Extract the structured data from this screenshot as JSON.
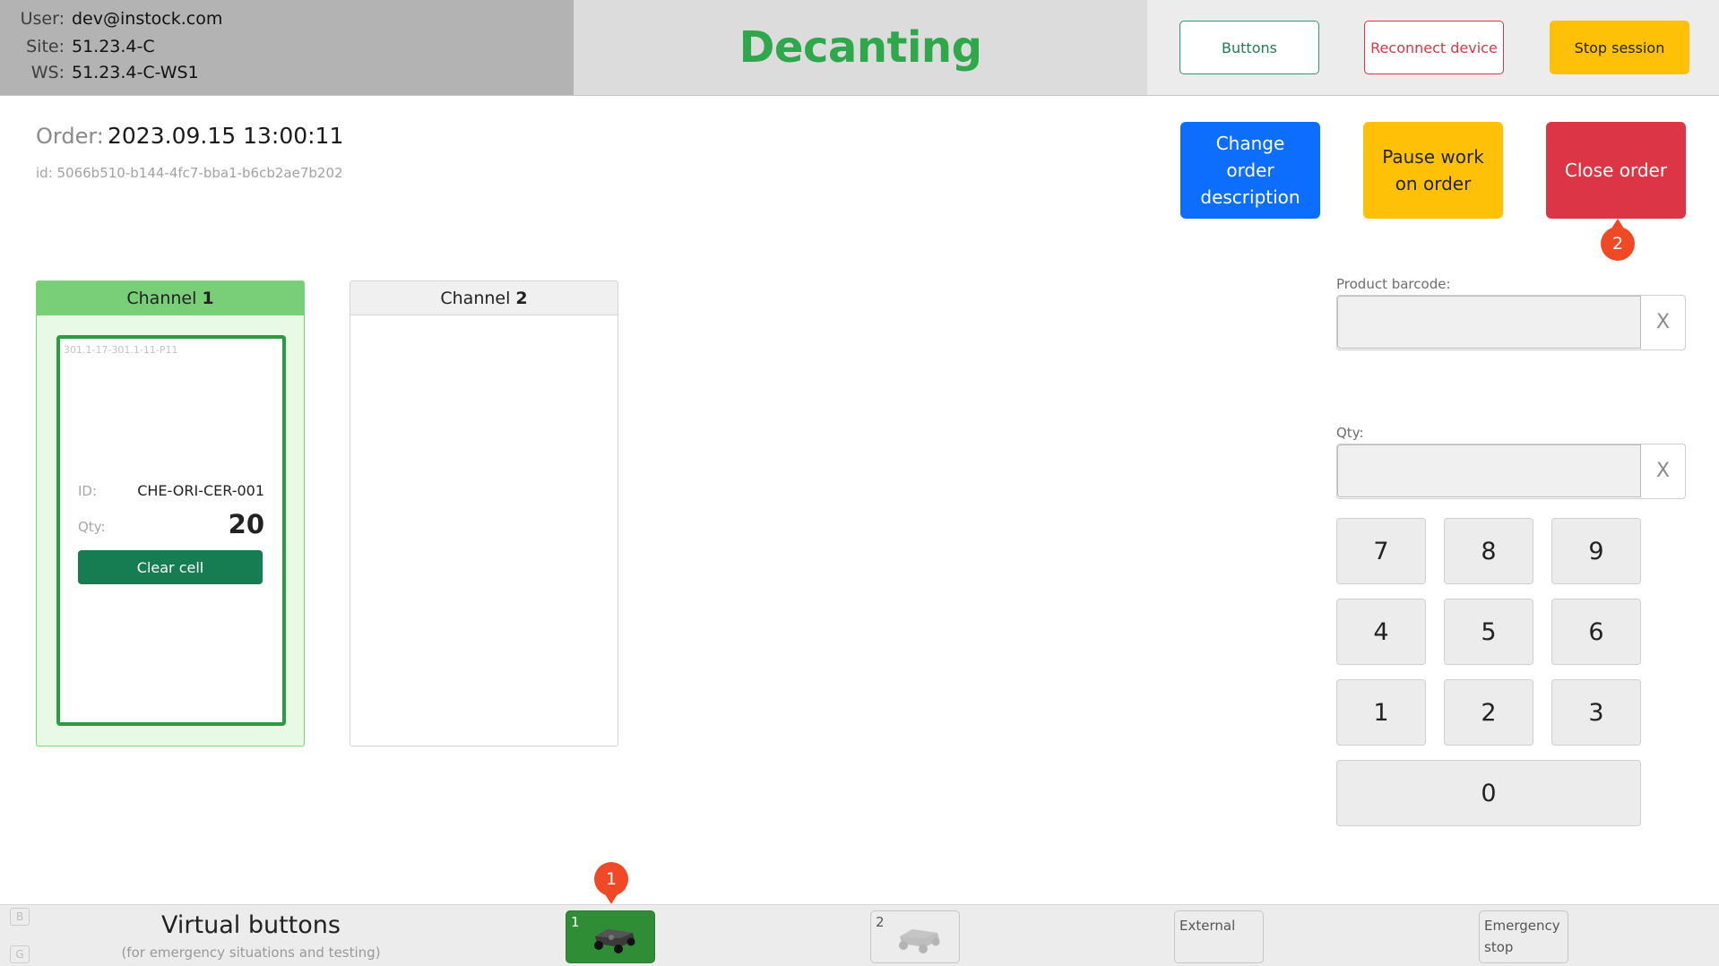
{
  "header": {
    "user_label": "User:",
    "user_value": "dev@instock.com",
    "site_label": "Site:",
    "site_value": "51.23.4-C",
    "ws_label": "WS:",
    "ws_value": "51.23.4-C-WS1",
    "title": "Decanting",
    "buttons_label": "Buttons",
    "reconnect_label": "Reconnect device",
    "stop_label": "Stop session"
  },
  "order": {
    "label": "Order:",
    "value": "2023.09.15 13:00:11",
    "id": "id: 5066b510-b144-4fc7-bba1-b6cb2ae7b202"
  },
  "actions": {
    "change_label": "Change order description",
    "pause_label": "Pause work on order",
    "close_label": "Close order"
  },
  "markers": {
    "close_order": "2",
    "vehicle_1": "1"
  },
  "channels": [
    {
      "name": "Channel",
      "number": "1",
      "cell": {
        "address": "301.1-17-301.1-11-P11",
        "id_label": "ID:",
        "id_value": "CHE-ORI-CER-001",
        "qty_label": "Qty:",
        "qty_value": "20",
        "clear_label": "Clear cell"
      }
    },
    {
      "name": "Channel",
      "number": "2"
    }
  ],
  "form": {
    "barcode_label": "Product barcode:",
    "qty_label": "Qty:",
    "clear_glyph": "X"
  },
  "keypad": [
    "7",
    "8",
    "9",
    "4",
    "5",
    "6",
    "1",
    "2",
    "3",
    "0"
  ],
  "bottom": {
    "hint_b": "B",
    "hint_g": "G",
    "title": "Virtual buttons",
    "subtitle": "(for emergency situations and testing)",
    "vehicle_1": "1",
    "vehicle_2": "2",
    "external": "External",
    "emergency": "Emergency stop",
    "vehicle_icon": "robot-vehicle-icon"
  },
  "colors": {
    "title_green": "#2fa74b",
    "primary": "#0d6efd",
    "warning": "#ffc107",
    "danger": "#dc3545",
    "success_dark": "#167c52",
    "marker": "#ef4a25"
  }
}
